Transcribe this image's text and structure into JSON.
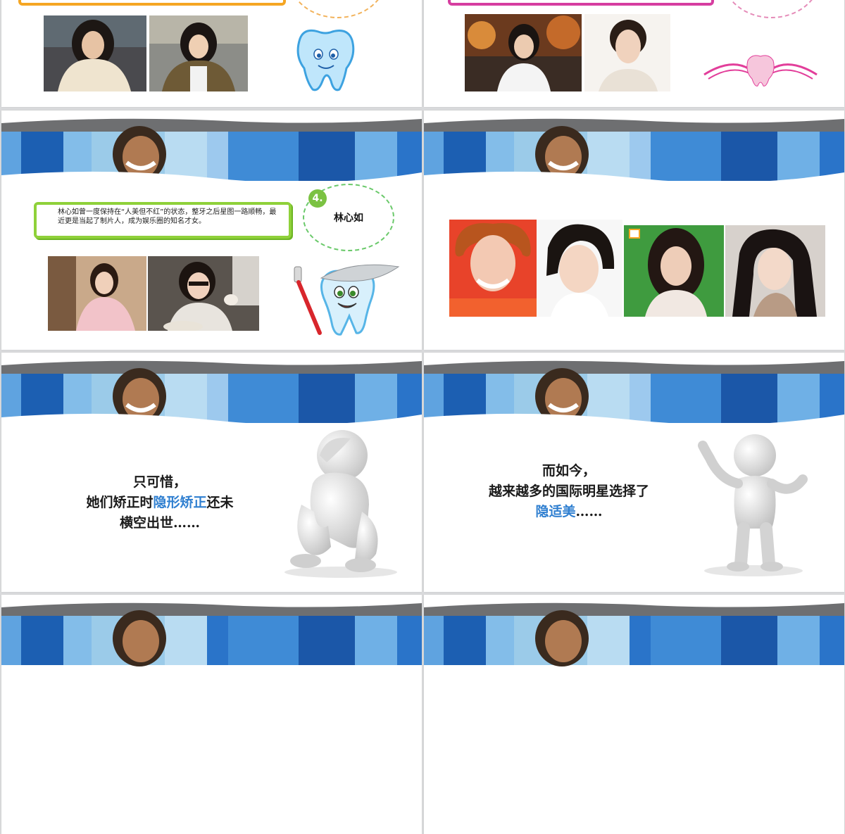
{
  "slide4": {
    "badge": "4.",
    "caption": "林心如曾一度保持在“人美但不红”的状态，整牙之后星图一路顺畅，最近更是当起了制片人，成为娱乐圈的知名才女。",
    "name": "林心如"
  },
  "slide5": {
    "line1": "只可惜，",
    "line2_a": "她们矫正时",
    "line2_accent": "隐形矫正",
    "line2_b": "还未",
    "line3": "横空出世……"
  },
  "slide6": {
    "line1": "而如今，",
    "line2": "越来越多的国际明星选择了",
    "line3_accent": "隐适美",
    "line3_b": "……"
  },
  "colors": {
    "accent_blue": "#2f7fd0",
    "lime_frame": "#8fd13a",
    "orange_frame": "#f5a623",
    "magenta_frame": "#d63ea0"
  }
}
